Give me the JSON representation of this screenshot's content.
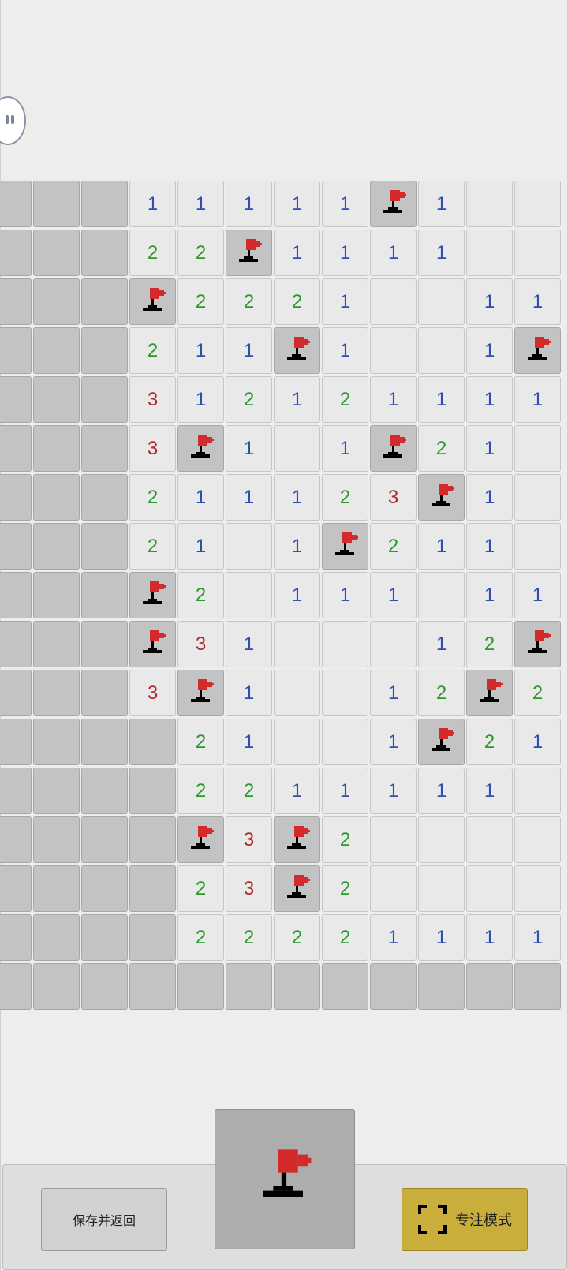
{
  "board": {
    "rows": [
      [
        "H",
        "H",
        "H",
        "1",
        "1",
        "1",
        "1",
        "1",
        "F",
        "1",
        "",
        ""
      ],
      [
        "H",
        "H",
        "H",
        "2",
        "2",
        "F",
        "1",
        "1",
        "1",
        "1",
        "",
        ""
      ],
      [
        "H",
        "H",
        "H",
        "F",
        "2",
        "2",
        "2",
        "1",
        "",
        "",
        "1",
        "1"
      ],
      [
        "H",
        "H",
        "H",
        "2",
        "1",
        "1",
        "F",
        "1",
        "",
        "",
        "1",
        "F"
      ],
      [
        "H",
        "H",
        "H",
        "3",
        "1",
        "2",
        "1",
        "2",
        "1",
        "1",
        "1",
        "1"
      ],
      [
        "H",
        "H",
        "H",
        "3",
        "F",
        "1",
        "",
        "1",
        "F",
        "2",
        "1",
        ""
      ],
      [
        "H",
        "H",
        "H",
        "2",
        "1",
        "1",
        "1",
        "2",
        "3",
        "F",
        "1",
        ""
      ],
      [
        "H",
        "H",
        "H",
        "2",
        "1",
        "",
        "1",
        "F",
        "2",
        "1",
        "1",
        ""
      ],
      [
        "H",
        "H",
        "H",
        "F",
        "2",
        "",
        "1",
        "1",
        "1",
        "",
        "1",
        "1"
      ],
      [
        "H",
        "H",
        "H",
        "F",
        "3",
        "1",
        "",
        "",
        "",
        "1",
        "2",
        "F"
      ],
      [
        "H",
        "H",
        "H",
        "3",
        "F",
        "1",
        "",
        "",
        "1",
        "2",
        "F",
        "2"
      ],
      [
        "H",
        "H",
        "H",
        "H",
        "2",
        "1",
        "",
        "",
        "1",
        "F",
        "2",
        "1"
      ],
      [
        "H",
        "H",
        "H",
        "H",
        "2",
        "2",
        "1",
        "1",
        "1",
        "1",
        "1",
        ""
      ],
      [
        "H",
        "H",
        "H",
        "H",
        "F",
        "3",
        "F",
        "2",
        "",
        "",
        "",
        ""
      ],
      [
        "H",
        "H",
        "H",
        "H",
        "2",
        "3",
        "F",
        "2",
        "",
        "",
        "",
        ""
      ],
      [
        "H",
        "H",
        "H",
        "H",
        "2",
        "2",
        "2",
        "2",
        "1",
        "1",
        "1",
        "1"
      ],
      [
        "H",
        "H",
        "H",
        "H",
        "H",
        "H",
        "H",
        "H",
        "H",
        "H",
        "H",
        "H"
      ]
    ],
    "number_colors": {
      "1": "#2f4fae",
      "2": "#2a9a2c",
      "3": "#b0262a"
    }
  },
  "controls": {
    "save_label": "保存并返回",
    "mode_icon": "flag-icon",
    "focus_label": "专注模式",
    "focus_icon": "fullscreen-corners-icon",
    "focus_color": "#c9ae3b"
  },
  "pause_icon": "pause-icon"
}
